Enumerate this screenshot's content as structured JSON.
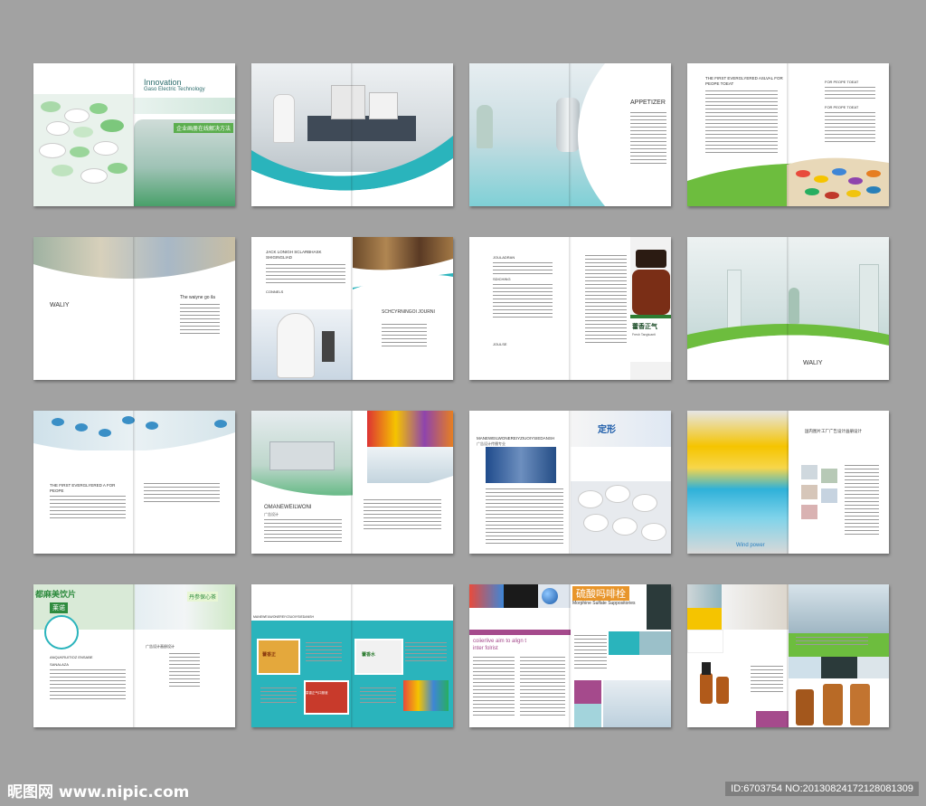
{
  "spreads": {
    "s1": {
      "title": "Innovation",
      "subtitle": "Gaso Electric Technology",
      "tag": "企业画册在线解决方法"
    },
    "s3": {
      "heading": "APPETIZER"
    },
    "s4": {
      "heading": "THE FIRST EVERGLYERED ASLVAL FOR PEOPE TOEAT",
      "side1": "FOR PEOPE TOEAT",
      "side2": "FOR PEOPE TOEAT"
    },
    "s5": {
      "left_heading": "WALIY",
      "right_heading": "The waiyne go ila"
    },
    "s6": {
      "top_heading": "JACK LONIGH SCLARBHASK SHIGINGLIAD",
      "small_heading": "CONNELS",
      "right_heading": "SCHCYRNINGOI JOURNI"
    },
    "s7": {
      "heading1": "JOULADRAN",
      "heading2": "SDICHING",
      "heading3": "JOULSE",
      "product_text": "藿香正气",
      "product_sub": "Fresh Tangtuanti"
    },
    "s8": {
      "heading": "WALIY"
    },
    "s9": {
      "heading": "THE FIRST EVERGLYERED A FOR PEOPE"
    },
    "s10": {
      "heading": "OMANEWEILWONI",
      "subheading": "广告设计"
    },
    "s11": {
      "heading": "MANEWEILWONEREIYZIUOIYSIEDANSH",
      "subheading": "广告设计传播专业",
      "sign": "定形"
    },
    "s12": {
      "heading": "国内图片工厂广告设计画册设计",
      "footer_text": "Wind power"
    },
    "s13": {
      "sign1": "都麻美饮片",
      "sign2": "莱诺",
      "sign3": "丹参保心茶",
      "heading": "ANQUKRUITIOZ ENSABE",
      "subheading": "SANALAZA",
      "right_heading": "广告设计画册设计"
    },
    "s14": {
      "caption": "MANEWEILWONEREIYZIUOIYSIEDANSH",
      "box1": "藿香正",
      "box2": "藿香水",
      "box3": "藿香正气口服液"
    },
    "s15": {
      "cn_title": "硫酸吗啡栓",
      "en_title": "Morphine Sulfate Suppositories",
      "headline1": "coiierlive aim to align t",
      "headline2": "inter folrist"
    }
  },
  "watermark": {
    "brand": "昵图网 www.nipic.com",
    "meta": "ID:6703754 NO:20130824172128081309"
  },
  "colors": {
    "teal": "#2ab4bc",
    "green": "#6dbd3e",
    "purple": "#a54a8c",
    "dark": "#333333"
  }
}
